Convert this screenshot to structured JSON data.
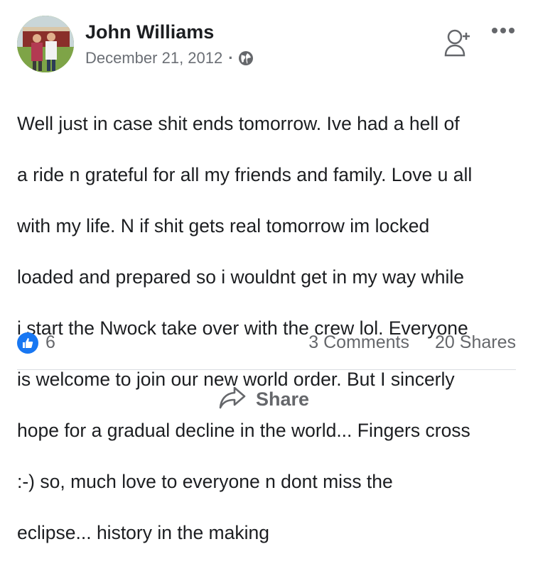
{
  "post": {
    "author": "John Williams",
    "date": "December 21, 2012",
    "separator": "·",
    "privacy_icon": "globe-icon",
    "text_lines": [
      "Well just in case shit ends tomorrow. Ive had a hell of",
      "a ride n grateful for all my friends and family. Love u all",
      "with my life. N if shit gets real tomorrow im locked",
      "loaded and prepared so i wouldnt get in my way while",
      "i start the Nwock take over with the crew lol. Everyone",
      "is welcome to join our new world order. But I sincerly",
      "hope for a gradual decline in the world... Fingers cross",
      ":-) so, much love to everyone n dont miss the",
      "eclipse... history in the making"
    ]
  },
  "stats": {
    "like_icon": "thumbs-up-icon",
    "likes": "6",
    "comments": "3 Comments",
    "shares": "20 Shares"
  },
  "actions": {
    "share_label": "Share",
    "share_icon": "share-arrow-icon"
  },
  "header_icons": {
    "add_friend": "add-friend-icon",
    "more": "more-options-icon"
  },
  "colors": {
    "like_blue": "#1877f2",
    "secondary_text": "#65676b",
    "primary_text": "#1c1e21"
  }
}
